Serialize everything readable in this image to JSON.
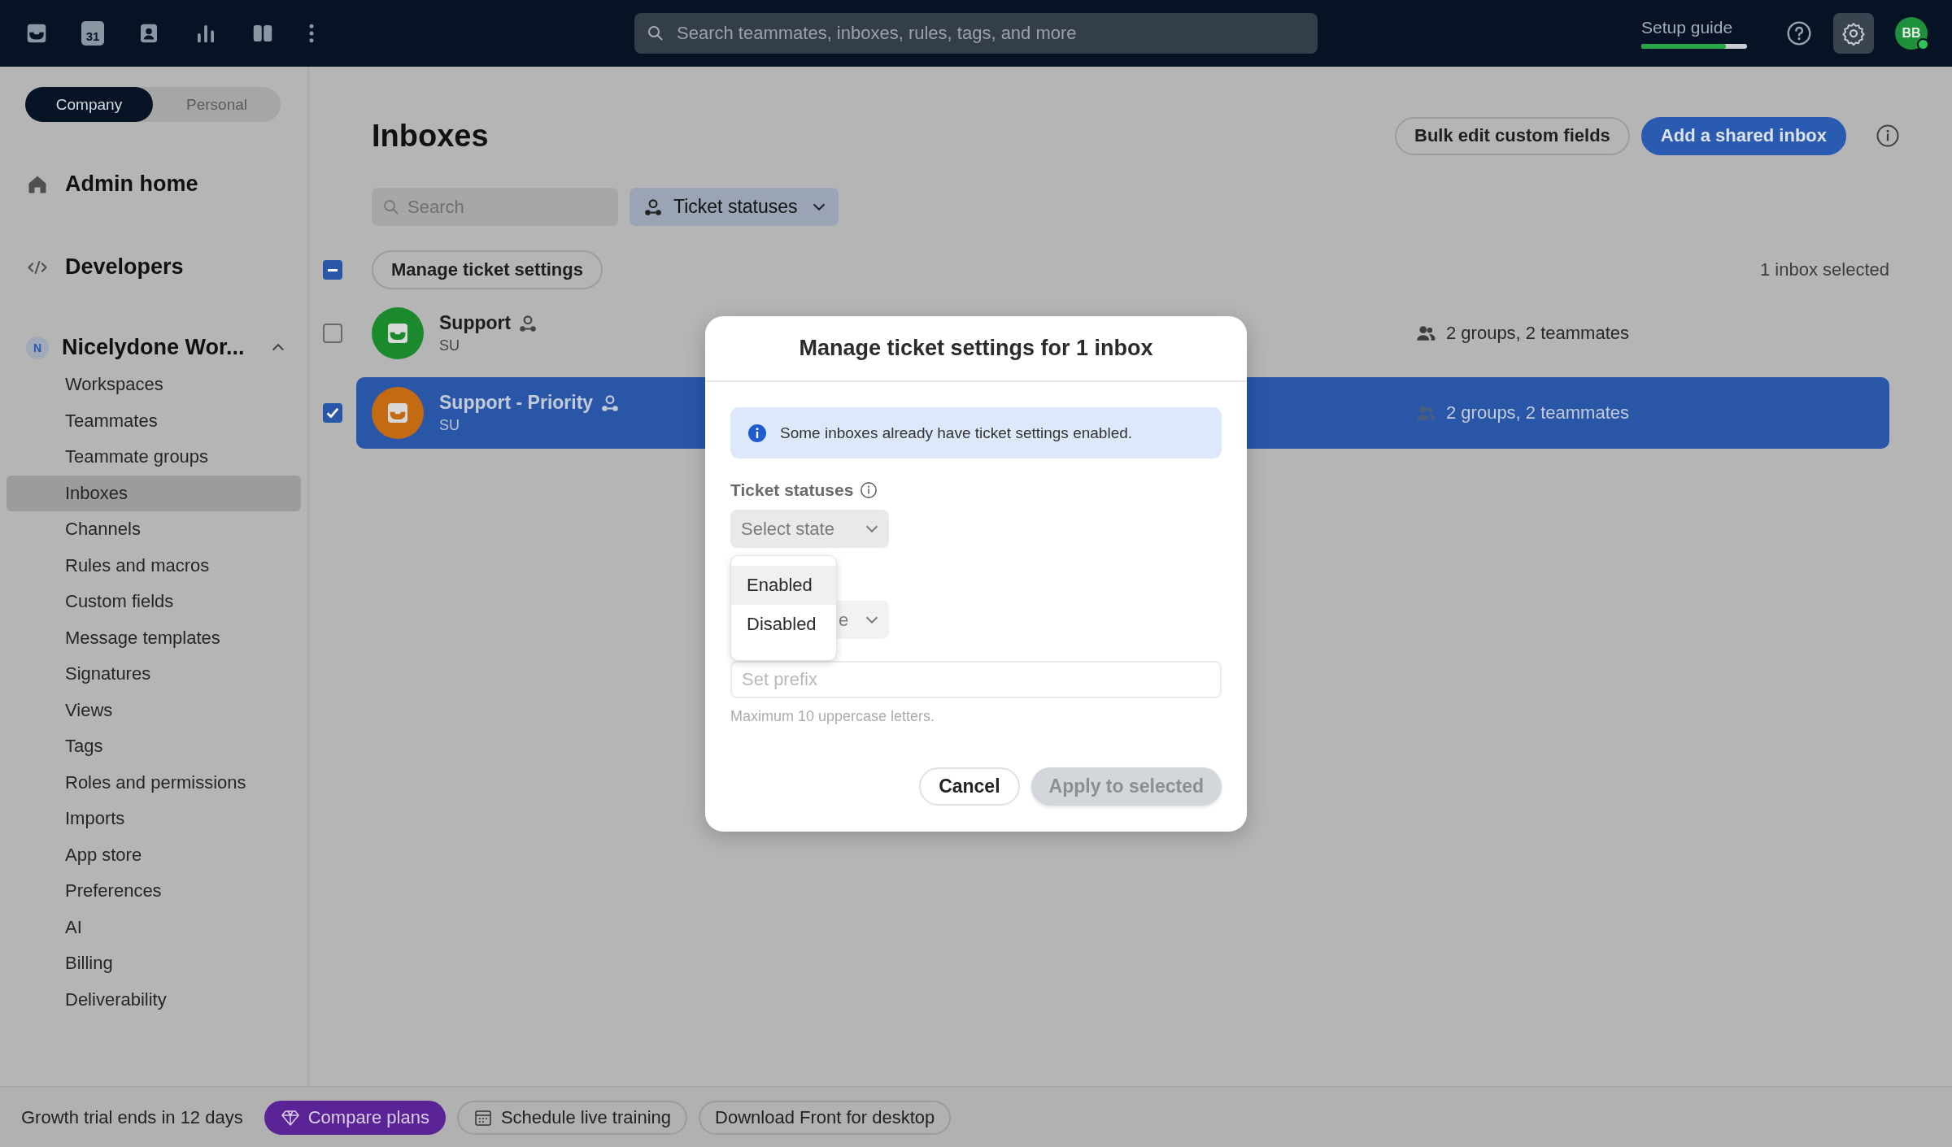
{
  "top_bar": {
    "calendar_day": "31",
    "search": {
      "placeholder": "Search teammates, inboxes, rules, tags, and more"
    },
    "setup_guide": {
      "label": "Setup guide",
      "level": 0.8
    },
    "avatar": {
      "initials": "BB"
    }
  },
  "sidebar": {
    "scope_tabs": [
      {
        "label": "Company",
        "selected": true
      },
      {
        "label": "Personal",
        "selected": false
      }
    ],
    "admin_home": "Admin home",
    "developers": "Developers",
    "workspace": {
      "initial": "N",
      "name": "Nicelydone Wor...",
      "expanded": true,
      "items": [
        {
          "label": "Workspaces",
          "selected": false
        },
        {
          "label": "Teammates",
          "selected": false
        },
        {
          "label": "Teammate groups",
          "selected": false
        },
        {
          "label": "Inboxes",
          "selected": true
        },
        {
          "label": "Channels",
          "selected": false
        },
        {
          "label": "Rules and macros",
          "selected": false
        },
        {
          "label": "Custom fields",
          "selected": false
        },
        {
          "label": "Message templates",
          "selected": false
        },
        {
          "label": "Signatures",
          "selected": false
        },
        {
          "label": "Views",
          "selected": false
        },
        {
          "label": "Tags",
          "selected": false
        },
        {
          "label": "Roles and permissions",
          "selected": false
        },
        {
          "label": "Imports",
          "selected": false
        },
        {
          "label": "App store",
          "selected": false
        },
        {
          "label": "Preferences",
          "selected": false
        },
        {
          "label": "AI",
          "selected": false
        },
        {
          "label": "Billing",
          "selected": false
        },
        {
          "label": "Deliverability",
          "selected": false
        }
      ]
    }
  },
  "main": {
    "title": "Inboxes",
    "header_buttons": [
      {
        "label": "Bulk edit custom fields",
        "kind": "secondary"
      },
      {
        "label": "Add a shared inbox",
        "kind": "primary"
      }
    ],
    "search": {
      "placeholder": "Search"
    },
    "filter": {
      "label": "Ticket statuses"
    },
    "select_all": {
      "partial": true
    },
    "bulk_action": "Manage ticket settings",
    "selection_count": "1 inbox selected",
    "inboxes": [
      {
        "name": "Support",
        "initials": "SU",
        "color": "#1b8a2c",
        "selected": false,
        "members": "2 groups, 2 teammates"
      },
      {
        "name": "Support - Priority",
        "initials": "SU",
        "color": "#c46a12",
        "selected": true,
        "members": "2 groups, 2 teammates"
      }
    ]
  },
  "modal": {
    "title": "Manage ticket settings for 1 inbox",
    "notice": "Some inboxes already have ticket settings enabled.",
    "field_label": "Ticket statuses",
    "select": {
      "placeholder": "Select state"
    },
    "options": [
      {
        "label": "Enabled",
        "selected": true
      },
      {
        "label": "Disabled",
        "selected": false
      }
    ],
    "second_select": {
      "value": "e"
    },
    "prefix": {
      "placeholder": "Set prefix"
    },
    "hint": "Maximum 10 uppercase letters.",
    "buttons": [
      {
        "label": "Cancel",
        "disabled": false,
        "kind": "secondary"
      },
      {
        "label": "Apply to selected",
        "disabled": true,
        "kind": "primary"
      }
    ]
  },
  "bottom_bar": {
    "trial": "Growth trial ends in 12 days",
    "buttons": [
      {
        "label": "Compare plans",
        "kind": "upgrade"
      },
      {
        "label": "Schedule live training",
        "kind": "training"
      },
      {
        "label": "Download Front for desktop",
        "kind": "download"
      }
    ]
  }
}
